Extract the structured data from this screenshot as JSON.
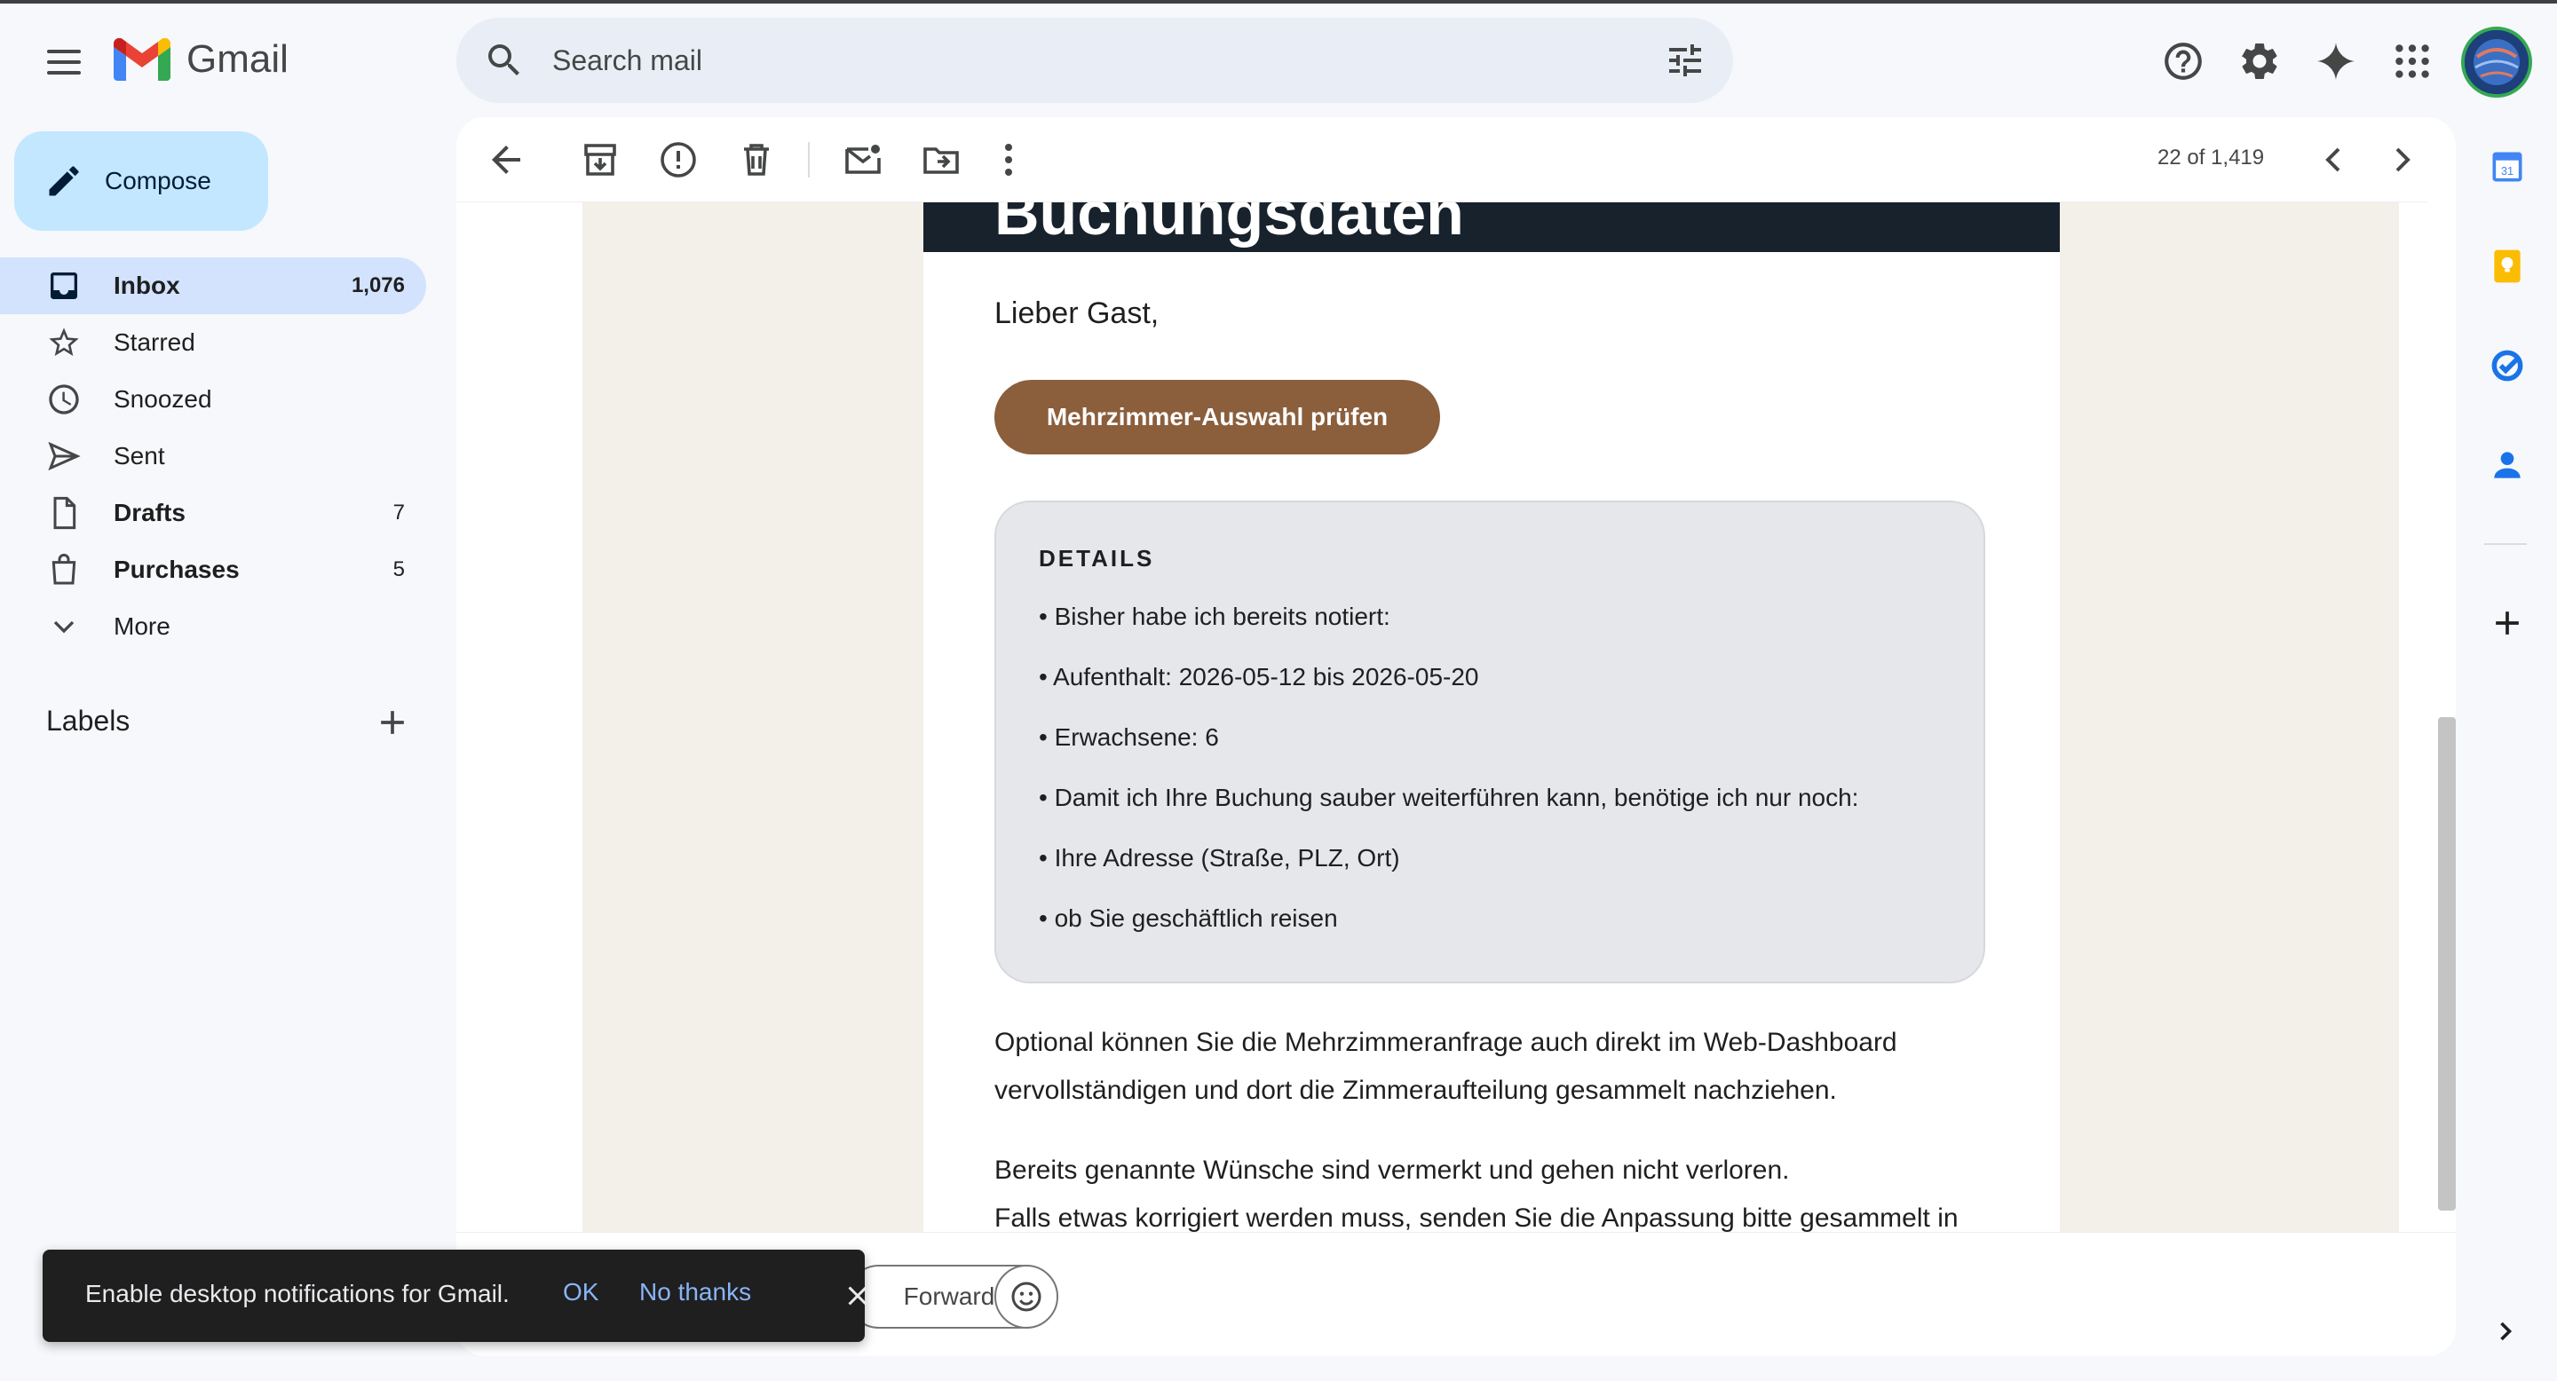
{
  "app": {
    "name": "Gmail"
  },
  "colors": {
    "compose_bg": "#c2e7ff",
    "active_nav": "#d3e3fd",
    "cta_brown": "#8b5e3c",
    "banner_dark": "#17222c"
  },
  "search": {
    "placeholder": "Search mail"
  },
  "compose": {
    "label": "Compose"
  },
  "nav": {
    "items": [
      {
        "label": "Inbox",
        "count": "1,076",
        "icon": "inbox-icon"
      },
      {
        "label": "Starred",
        "count": "",
        "icon": "star-icon"
      },
      {
        "label": "Snoozed",
        "count": "",
        "icon": "clock-icon"
      },
      {
        "label": "Sent",
        "count": "",
        "icon": "send-icon"
      },
      {
        "label": "Drafts",
        "count": "7",
        "icon": "draft-icon"
      },
      {
        "label": "Purchases",
        "count": "5",
        "icon": "shopping-bag-icon"
      },
      {
        "label": "More",
        "count": "",
        "icon": "chevron-down-icon"
      }
    ]
  },
  "labels": {
    "title": "Labels"
  },
  "toolbar": {
    "pager": "22 of 1,419"
  },
  "email": {
    "banner_title": "Buchungsdaten",
    "greeting": "Lieber Gast,",
    "cta_label": "Mehrzimmer-Auswahl prüfen",
    "details_title": "DETAILS",
    "details_items": [
      "• Bisher habe ich bereits notiert:",
      "• Aufenthalt: 2026-05-12 bis 2026-05-20",
      "• Erwachsene: 6",
      "• Damit ich Ihre Buchung sauber weiterführen kann, benötige ich nur noch:",
      "• Ihre Adresse (Straße, PLZ, Ort)",
      "• ob Sie geschäftlich reisen"
    ],
    "paragraph_1": "Optional können Sie die Mehrzimmeranfrage auch direkt im Web-Dashboard vervollständigen und dort die Zimmeraufteilung gesammelt nachziehen.",
    "paragraph_2_line_1": "Bereits genannte Wünsche sind vermerkt und gehen nicht verloren.",
    "paragraph_2_line_2": "Falls etwas korrigiert werden muss, senden Sie die Anpassung bitte gesammelt in"
  },
  "reply": {
    "forward_label": "Forward"
  },
  "toast": {
    "message": "Enable desktop notifications for Gmail.",
    "ok": "OK",
    "no_thanks": "No thanks"
  }
}
